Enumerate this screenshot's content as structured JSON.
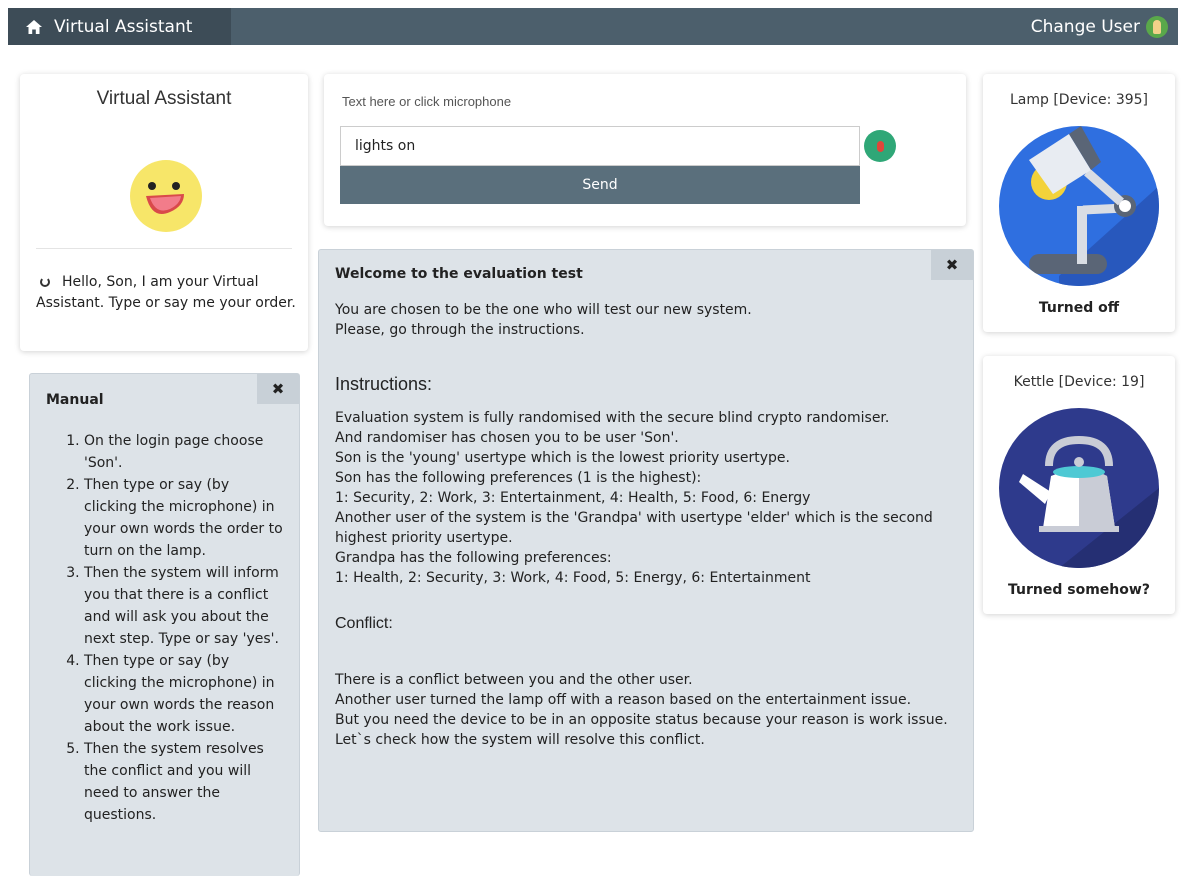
{
  "navbar": {
    "brand": "Virtual Assistant",
    "user_label": "Change User"
  },
  "assistant": {
    "title": "Virtual Assistant",
    "message": "Hello, Son, I am your Virtual Assistant. Type or say me your order."
  },
  "input": {
    "hint": "Text here or click microphone",
    "value": "lights on",
    "send_label": "Send"
  },
  "welcome": {
    "title": "Welcome to the evaluation test",
    "intro": [
      "You are chosen to be the one who will test our new system.",
      "Please, go through the instructions."
    ],
    "instructions_heading": "Instructions:",
    "instructions": [
      "Evaluation system is fully randomised with the secure blind crypto randomiser.",
      "And randomiser has chosen you to be user 'Son'.",
      "Son is the 'young' usertype which is the lowest priority usertype.",
      "Son has the following preferences (1 is the highest):",
      "1: Security, 2: Work, 3: Entertainment, 4: Health, 5: Food, 6: Energy",
      "Another user of the system is the 'Grandpa' with usertype 'elder' which is the second highest priority usertype.",
      "Grandpa has the following preferences:",
      "1: Health, 2: Security, 3: Work, 4: Food, 5: Energy, 6: Entertainment"
    ],
    "conflict_heading": "Conflict:",
    "conflict": [
      "There is a conflict between you and the other user.",
      "Another user turned the lamp off with a reason based on the entertainment issue.",
      "But you need the device to be in an opposite status because your reason is work issue.",
      "Let`s check how the system will resolve this conflict."
    ]
  },
  "manual": {
    "title": "Manual",
    "steps": [
      "On the login page choose 'Son'.",
      "Then type or say (by clicking the microphone) in your own words the order to turn on the lamp.",
      "Then the system will inform you that there is a conflict and will ask you about the next step. Type or say 'yes'.",
      "Then type or say (by clicking the microphone) in your own words the reason about the work issue.",
      "Then the system resolves the conflict and you will need to answer the questions."
    ]
  },
  "devices": [
    {
      "title": "Lamp [Device: 395]",
      "status": "Turned off",
      "icon": "lamp-icon"
    },
    {
      "title": "Kettle [Device: 19]",
      "status": "Turned somehow?",
      "icon": "kettle-icon"
    }
  ],
  "colors": {
    "navbar": "#4c5f6c",
    "brand_bg": "#3d4c57",
    "send_button": "#5a6f7c",
    "panel_gray": "#dde3e8",
    "mic": "#2fa777",
    "lamp_circle": "#2f6fe0",
    "kettle_circle": "#2e3a8c"
  }
}
